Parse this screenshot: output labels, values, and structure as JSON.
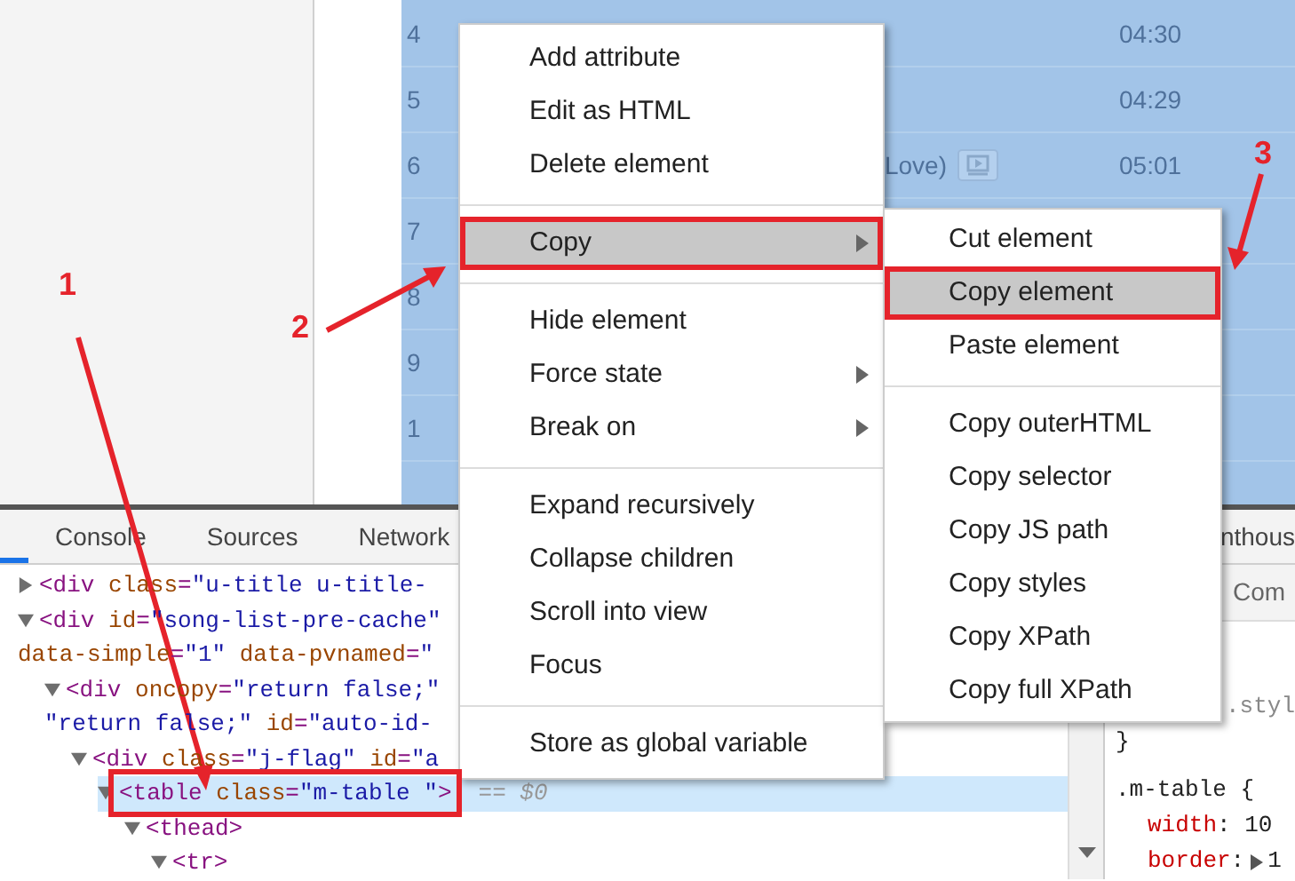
{
  "page": {
    "rows": [
      {
        "number": "4",
        "time": "04:30"
      },
      {
        "number": "5",
        "time": "04:29"
      },
      {
        "number": "6",
        "title": "Love)",
        "video": true,
        "time": "05:01"
      },
      {
        "number": "7"
      },
      {
        "number": "8"
      },
      {
        "number": "9"
      },
      {
        "number": "1"
      }
    ]
  },
  "devtools": {
    "tabs": [
      {
        "label": "Console",
        "selected": false
      },
      {
        "label": "Sources",
        "selected": false
      },
      {
        "label": "Network",
        "selected": false
      },
      {
        "label": "nthous",
        "selected": false
      }
    ],
    "tree": [
      {
        "expanded": false,
        "selected": false,
        "marked": false,
        "lines": [
          [
            {
              "kind": "tag",
              "text": "<div"
            },
            {
              "kind": "attr",
              "text": " class"
            },
            {
              "kind": "tag",
              "text": "="
            },
            {
              "kind": "value",
              "text": "\"u-title u-title-"
            }
          ]
        ]
      },
      {
        "expanded": true,
        "selected": false,
        "marked": false,
        "lines": [
          [
            {
              "kind": "tag",
              "text": "<div"
            },
            {
              "kind": "attr",
              "text": " id"
            },
            {
              "kind": "tag",
              "text": "="
            },
            {
              "kind": "value",
              "text": "\"song-list-pre-cache\""
            }
          ],
          [
            {
              "kind": "attr",
              "text": "data-simple"
            },
            {
              "kind": "tag",
              "text": "="
            },
            {
              "kind": "value",
              "text": "\"1\""
            },
            {
              "kind": "attr",
              "text": " data-pvnamed"
            },
            {
              "kind": "tag",
              "text": "="
            },
            {
              "kind": "value",
              "text": "\""
            }
          ]
        ],
        "children": [
          {
            "expanded": true,
            "selected": false,
            "marked": false,
            "lines": [
              [
                {
                  "kind": "tag",
                  "text": "<div"
                },
                {
                  "kind": "attr",
                  "text": " oncopy"
                },
                {
                  "kind": "tag",
                  "text": "="
                },
                {
                  "kind": "value",
                  "text": "\"return false;\""
                }
              ],
              [
                {
                  "kind": "value",
                  "text": "\"return false;\""
                },
                {
                  "kind": "attr",
                  "text": " id"
                },
                {
                  "kind": "tag",
                  "text": "="
                },
                {
                  "kind": "value",
                  "text": "\"auto-id-"
                }
              ]
            ],
            "children": [
              {
                "expanded": true,
                "selected": false,
                "marked": false,
                "lines": [
                  [
                    {
                      "kind": "tag",
                      "text": "<div"
                    },
                    {
                      "kind": "attr",
                      "text": " class"
                    },
                    {
                      "kind": "tag",
                      "text": "="
                    },
                    {
                      "kind": "value",
                      "text": "\"j-flag\""
                    },
                    {
                      "kind": "attr",
                      "text": " id"
                    },
                    {
                      "kind": "tag",
                      "text": "="
                    },
                    {
                      "kind": "value",
                      "text": "\"a"
                    }
                  ]
                ],
                "children": [
                  {
                    "expanded": true,
                    "selected": true,
                    "marked": true,
                    "lines": [
                      [
                        {
                          "kind": "tag",
                          "text": "<table"
                        },
                        {
                          "kind": "attr",
                          "text": " class"
                        },
                        {
                          "kind": "tag",
                          "text": "="
                        },
                        {
                          "kind": "value",
                          "text": "\"m-table \""
                        },
                        {
                          "kind": "tag",
                          "text": ">"
                        }
                      ]
                    ],
                    "suffix": "== $0",
                    "children": [
                      {
                        "expanded": true,
                        "selected": false,
                        "marked": false,
                        "lines": [
                          [
                            {
                              "kind": "tag",
                              "text": "<thead>"
                            }
                          ]
                        ],
                        "children": [
                          {
                            "expanded": true,
                            "selected": false,
                            "marked": false,
                            "lines": [
                              [
                                {
                                  "kind": "tag",
                                  "text": "<tr>"
                                }
                              ]
                            ]
                          }
                        ]
                      }
                    ]
                  }
                ]
              }
            ]
          }
        ]
      }
    ],
    "styles": {
      "filter": "Com",
      "lines": [
        [
          {
            "kind": "selector",
            "text": ".styl"
          }
        ],
        [
          {
            "kind": "punct",
            "text": "}"
          }
        ],
        [
          {
            "kind": "selector",
            "text": ".m-table {"
          }
        ],
        [
          {
            "kind": "prop",
            "text": "width"
          },
          {
            "kind": "punct",
            "text": ": 10"
          }
        ],
        [
          {
            "kind": "prop",
            "text": "border"
          },
          {
            "kind": "punct",
            "text": ":"
          },
          {
            "kind": "triangle"
          },
          {
            "kind": "punct",
            "text": "1"
          }
        ]
      ]
    }
  },
  "context_menu": {
    "groups": [
      [
        {
          "label": "Add attribute",
          "highlighted": false,
          "marked": false,
          "submenu": false
        },
        {
          "label": "Edit as HTML",
          "highlighted": false,
          "marked": false,
          "submenu": false
        },
        {
          "label": "Delete element",
          "highlighted": false,
          "marked": false,
          "submenu": false
        }
      ],
      [
        {
          "label": "Copy",
          "highlighted": true,
          "marked": true,
          "submenu": true
        }
      ],
      [
        {
          "label": "Hide element",
          "highlighted": false,
          "marked": false,
          "submenu": false
        },
        {
          "label": "Force state",
          "highlighted": false,
          "marked": false,
          "submenu": true
        },
        {
          "label": "Break on",
          "highlighted": false,
          "marked": false,
          "submenu": true
        }
      ],
      [
        {
          "label": "Expand recursively",
          "highlighted": false,
          "marked": false,
          "submenu": false
        },
        {
          "label": "Collapse children",
          "highlighted": false,
          "marked": false,
          "submenu": false
        },
        {
          "label": "Scroll into view",
          "highlighted": false,
          "marked": false,
          "submenu": false
        },
        {
          "label": "Focus",
          "highlighted": false,
          "marked": false,
          "submenu": false
        }
      ],
      [
        {
          "label": "Store as global variable",
          "highlighted": false,
          "marked": false,
          "submenu": false
        }
      ]
    ]
  },
  "submenu": {
    "groups": [
      [
        {
          "label": "Cut element",
          "highlighted": false,
          "marked": false
        },
        {
          "label": "Copy element",
          "highlighted": true,
          "marked": true
        },
        {
          "label": "Paste element",
          "highlighted": false,
          "marked": false
        }
      ],
      [
        {
          "label": "Copy outerHTML",
          "highlighted": false,
          "marked": false
        },
        {
          "label": "Copy selector",
          "highlighted": false,
          "marked": false
        },
        {
          "label": "Copy JS path",
          "highlighted": false,
          "marked": false
        },
        {
          "label": "Copy styles",
          "highlighted": false,
          "marked": false
        },
        {
          "label": "Copy XPath",
          "highlighted": false,
          "marked": false
        },
        {
          "label": "Copy full XPath",
          "highlighted": false,
          "marked": false
        }
      ]
    ]
  },
  "annotations": [
    {
      "label": "1"
    },
    {
      "label": "2"
    },
    {
      "label": "3"
    }
  ]
}
